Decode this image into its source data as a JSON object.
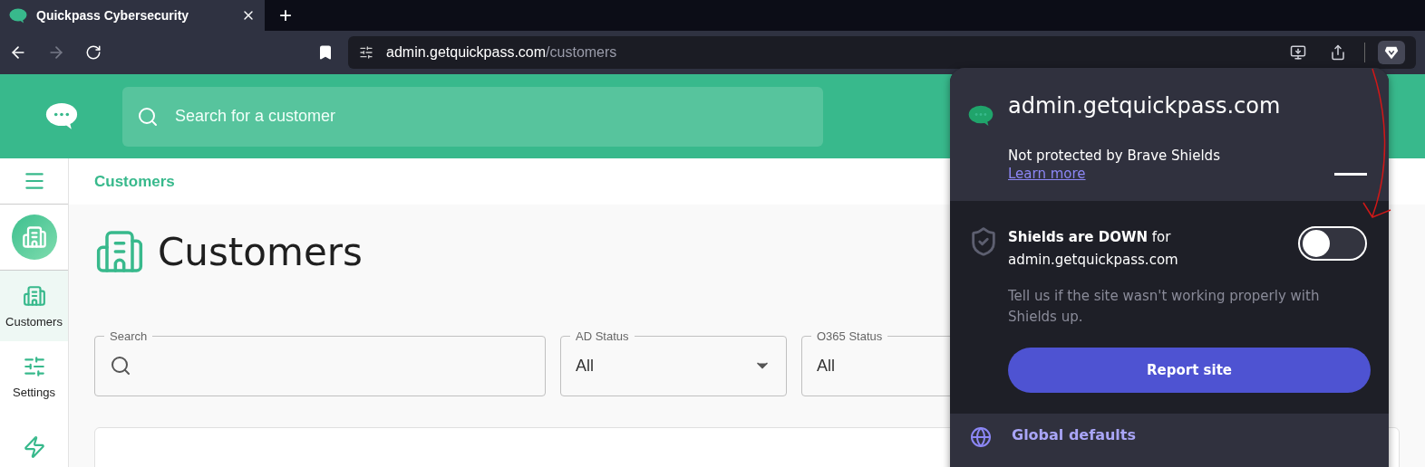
{
  "browser": {
    "tab": {
      "title": "Quickpass Cybersecurity",
      "selected": true
    },
    "new_tab": "+",
    "address": {
      "host": "admin.getquickpass.com",
      "path": "/customers"
    }
  },
  "header": {
    "search": {
      "placeholder": "Search for a customer"
    }
  },
  "sidebar": {
    "items": [
      {
        "kind": "building",
        "label": "Customers",
        "selected": true
      },
      {
        "kind": "sliders",
        "label": "Settings",
        "selected": false
      },
      {
        "kind": "bolt",
        "selected": false
      }
    ]
  },
  "breadcrumb": "Customers",
  "page_title": "Customers",
  "filters": [
    {
      "kind": "search",
      "label": "Search"
    },
    {
      "kind": "select",
      "label": "AD Status",
      "value": "All"
    },
    {
      "kind": "select",
      "label": "O365 Status",
      "value": "All"
    }
  ],
  "shields_panel": {
    "site": "admin.getquickpass.com",
    "status": "Not protected by Brave Shields",
    "link": "Learn more",
    "toggle": {
      "title": "**Shields are DOWN** for admin.getquickpass.com",
      "on": false
    },
    "note": "Tell us if the site wasn't working properly with Shields up.",
    "button": "Report site",
    "footer": "Global defaults"
  }
}
